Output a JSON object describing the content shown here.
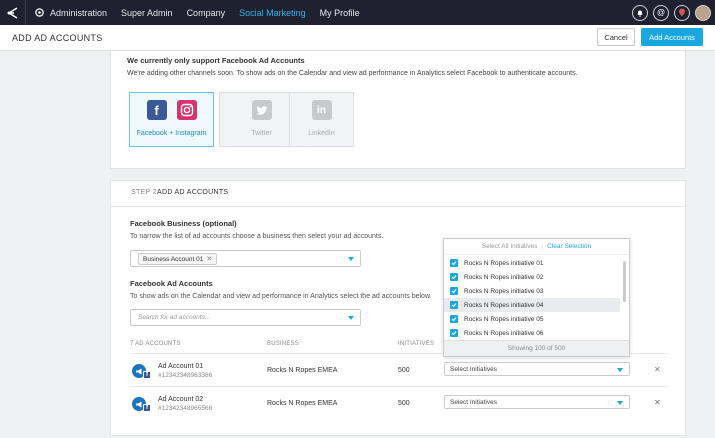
{
  "nav": {
    "items": [
      {
        "label": "Administration",
        "active": false
      },
      {
        "label": "Super Admin",
        "active": false
      },
      {
        "label": "Company",
        "active": false
      },
      {
        "label": "Social Marketing",
        "active": true
      },
      {
        "label": "My Profile",
        "active": false
      }
    ],
    "right_icons": [
      "bell-icon",
      "mention-icon",
      "location-icon",
      "avatar"
    ]
  },
  "header": {
    "title": "ADD AD ACCOUNTS",
    "cancel_label": "Cancel",
    "add_label": "Add Accounts"
  },
  "channels": {
    "title": "We currently only support Facebook Ad Accounts",
    "description": "We're adding other channels soon. To show ads on the Calendar and view ad performance in Analytics select Facebook to authenticate accounts.",
    "tiles": [
      {
        "label": "Facebook + Instagram",
        "selected": true
      },
      {
        "label": "Twitter",
        "selected": false
      },
      {
        "label": "LinkedIn",
        "selected": false
      }
    ]
  },
  "step": {
    "number": "STEP 2",
    "title": "ADD AD ACCOUNTS",
    "business_label": "Facebook Business (optional)",
    "business_hint": "To narrow the list of ad accounts choose a business then select your ad accounts.",
    "business_chip": "Business Account 01",
    "accounts_label": "Facebook Ad Accounts",
    "accounts_hint": "To show ads on the Calendar and view ad performance in Analytics select the ad accounts below.",
    "search_placeholder": "Search for ad accounts..."
  },
  "table": {
    "headers": {
      "accounts": "7 AD ACCOUNTS",
      "business": "BUSINESS",
      "initiatives": "INITIATIVES"
    },
    "rows": [
      {
        "name": "Ad Account 01",
        "id": "#12342348963366",
        "business": "Rocks N Ropes EMEA",
        "initiatives": "500",
        "select_label": "Select Initiatives"
      },
      {
        "name": "Ad Account 02",
        "id": "#12342348965566",
        "business": "Rocks N Ropes EMEA",
        "initiatives": "500",
        "select_label": "Select Initiatives"
      }
    ]
  },
  "dropdown": {
    "select_all": "Select All Initiatives",
    "divider": "|",
    "clear": "Clear Selection",
    "items": [
      {
        "label": "Rocks N Ropes initiative 01",
        "checked": true
      },
      {
        "label": "Rocks N Ropes initiative 02",
        "checked": true
      },
      {
        "label": "Rocks N Ropes initiative 03",
        "checked": true
      },
      {
        "label": "Rocks N Ropes initiative 04",
        "checked": true
      },
      {
        "label": "Rocks N Ropes initiative 05",
        "checked": true
      },
      {
        "label": "Rocks N Ropes initiative 06",
        "checked": true
      }
    ],
    "footer": "Showing 100 of 500"
  },
  "colors": {
    "nav_bg": "#1f2131",
    "accent": "#1aa7e0",
    "facebook": "#3b5998",
    "instagram": "#d6346c"
  }
}
